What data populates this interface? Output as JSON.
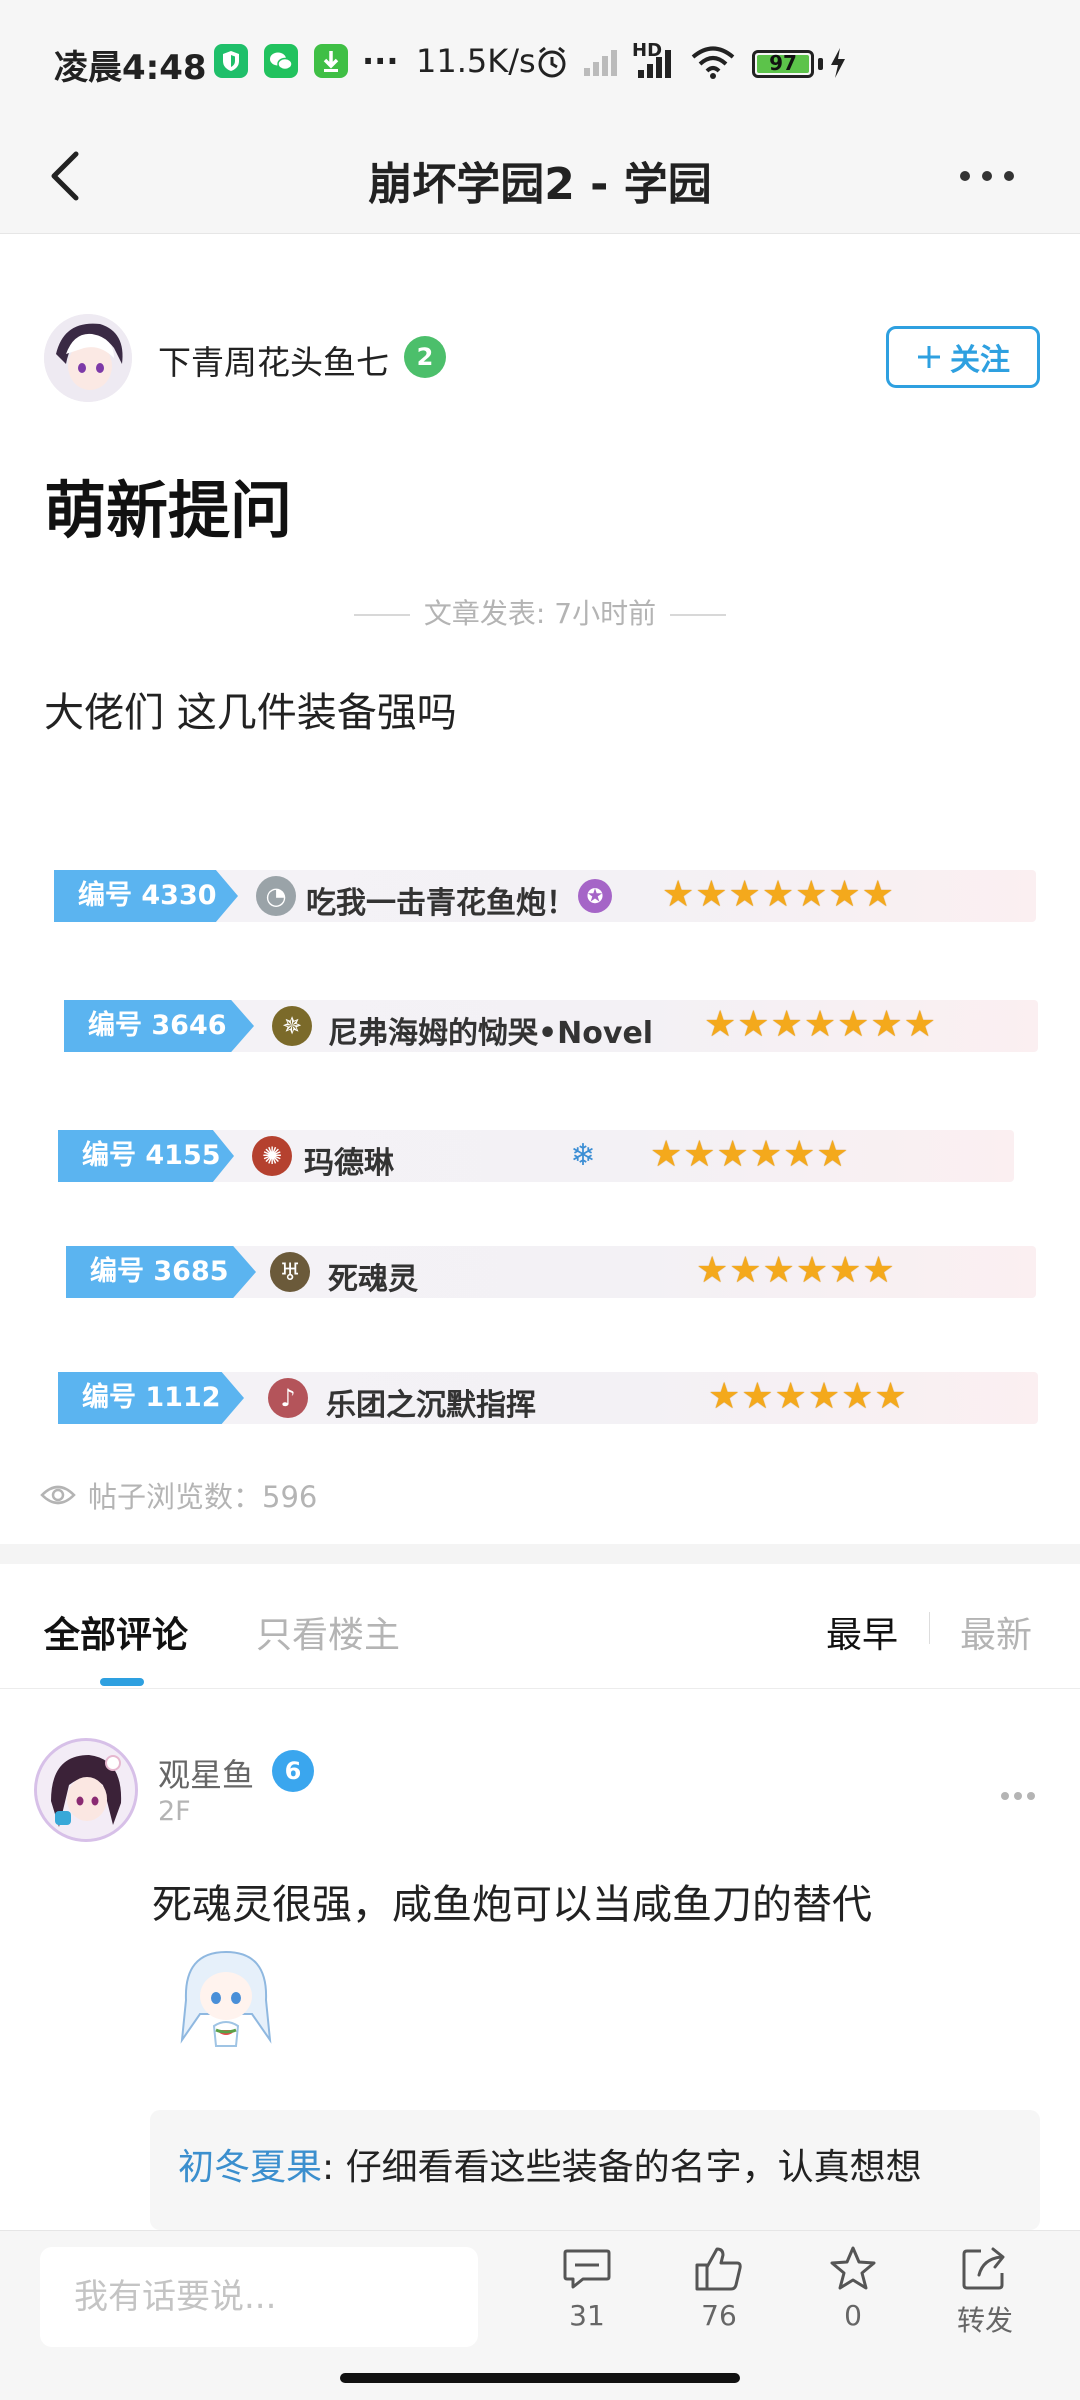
{
  "status_bar": {
    "time": "凌晨4:48",
    "net_speed": "11.5K/s",
    "network_type": "HD",
    "battery": "97",
    "battery_level": 0.97,
    "app_icons": [
      "shield-app-icon",
      "wechat-icon",
      "download-icon"
    ],
    "colors": {
      "shield": "#1fbf6a",
      "wechat": "#21c25e",
      "download": "#3fbf45",
      "battery": "#5cc34a"
    }
  },
  "nav": {
    "title": "崩坏学园2 - 学园"
  },
  "post": {
    "author_name": "下青周花头鱼七",
    "author_level": "2",
    "follow_label": "关注",
    "title": "萌新提问",
    "meta": "文章发表: 7小时前",
    "body": "大佬们  这几件装备强吗",
    "equipment": [
      {
        "tag": "编号 4330",
        "name": "吃我一击青花鱼炮！",
        "stars": "★★★★★★★",
        "icon": "fish-cannon-icon"
      },
      {
        "tag": "编号 3646",
        "name": "尼弗海姆的恸哭•Novel",
        "stars": "★★★★★★★",
        "icon": "niflheim-icon"
      },
      {
        "tag": "编号 4155",
        "name": "玛德琳",
        "stars": "★★★★★★",
        "icon": "madeline-icon"
      },
      {
        "tag": "编号 3685",
        "name": "死魂灵",
        "stars": "★★★★★★",
        "icon": "dead-souls-icon"
      },
      {
        "tag": "编号 1112",
        "name": "乐团之沉默指挥",
        "stars": "★★★★★★",
        "icon": "violin-icon"
      }
    ],
    "views": "帖子浏览数：596"
  },
  "comment_tabs": {
    "all": "全部评论",
    "op_only": "只看楼主",
    "earliest": "最早",
    "latest": "最新"
  },
  "comments": [
    {
      "user": "观星鱼",
      "level": "6",
      "floor": "2F",
      "text": "死魂灵很强，咸鱼炮可以当咸鱼刀的替代",
      "reply": {
        "user": "初冬夏果",
        "text": ": 仔细看看这些装备的名字，认真想想"
      }
    }
  ],
  "bottom_bar": {
    "placeholder": "我有话要说...",
    "comment_count": "31",
    "like_count": "76",
    "favorite_count": "0",
    "share_label": "转发"
  },
  "colors": {
    "accent": "#2ea0e0",
    "tag_blue": "#5bb4f0",
    "star_gold": "#f4a91c",
    "level2_badge": "#4cbf6b",
    "level6_badge": "#3aa6ee"
  }
}
